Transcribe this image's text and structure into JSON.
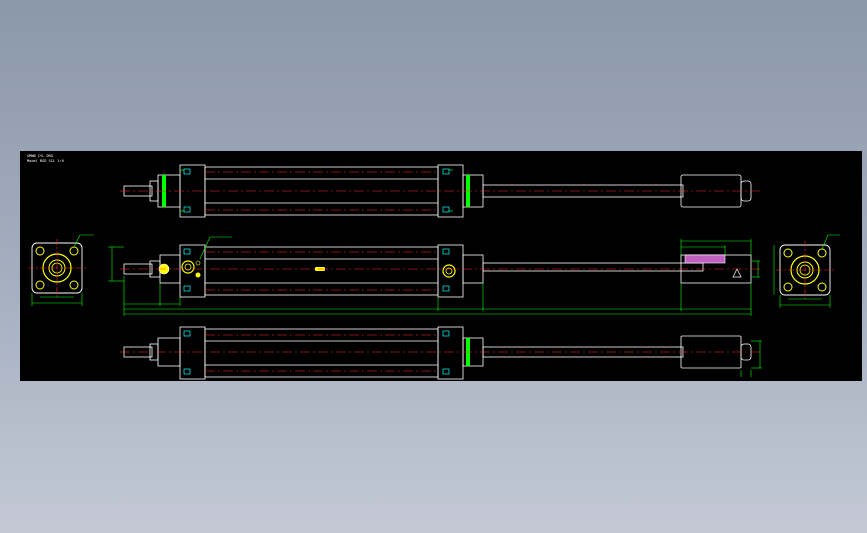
{
  "title_block": {
    "line1": "SMWB  CYL  DRG",
    "line2": "Model  BSD  SCL 1:0"
  },
  "colors": {
    "background": "#000000",
    "outline": "#ffffff",
    "centerline": "#ff2a2a",
    "dimension": "#00ff00",
    "feature": "#ffff00",
    "annotation": "#00ffff",
    "highlight": "#c060c0"
  },
  "icons": [
    "port-marker-icon",
    "cushion-screw-icon",
    "end-cap-bolt-icon"
  ]
}
